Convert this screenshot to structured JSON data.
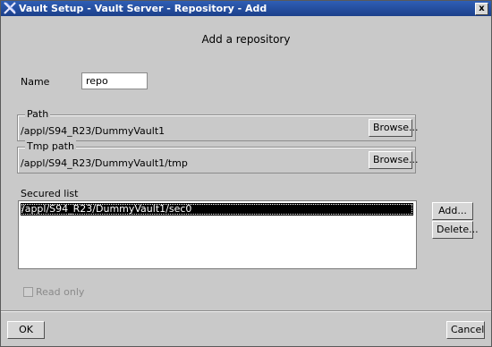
{
  "window": {
    "title": "Vault Setup - Vault Server - Repository - Add",
    "close_label": "x"
  },
  "heading": "Add a repository",
  "name_field": {
    "label": "Name",
    "value": "repo"
  },
  "path_group": {
    "legend": "Path",
    "value": "/appl/S94_R23/DummyVault1",
    "browse_label": "Browse..."
  },
  "tmp_path_group": {
    "legend": "Tmp path",
    "value": "/appl/S94_R23/DummyVault1/tmp",
    "browse_label": "Browse..."
  },
  "secured_list": {
    "label": "Secured list",
    "items": [
      "/appl/S94_R23/DummyVault1/sec0"
    ],
    "add_label": "Add...",
    "delete_label": "Delete..."
  },
  "read_only": {
    "label": "Read only",
    "checked": false,
    "disabled": true
  },
  "footer": {
    "ok_label": "OK",
    "cancel_label": "Cancel"
  },
  "colors": {
    "titlebar": "#1c3f8a",
    "background": "#c9c9c9",
    "selection": "#000000"
  }
}
